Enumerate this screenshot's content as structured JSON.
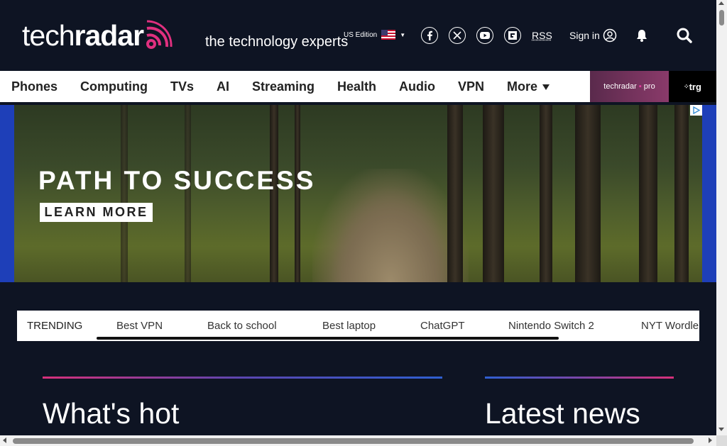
{
  "header": {
    "logo_light": "tech",
    "logo_bold": "radar",
    "tagline": "the technology experts",
    "edition_label": "US Edition",
    "rss_label": "RSS",
    "signin_label": "Sign in"
  },
  "nav": {
    "items": [
      {
        "label": "Phones"
      },
      {
        "label": "Computing"
      },
      {
        "label": "TVs"
      },
      {
        "label": "AI"
      },
      {
        "label": "Streaming"
      },
      {
        "label": "Health"
      },
      {
        "label": "Audio"
      },
      {
        "label": "VPN"
      },
      {
        "label": "More"
      }
    ],
    "pro_label_a": "techradar",
    "pro_label_b": "pro",
    "trg_label": "trg"
  },
  "ad": {
    "title": "PATH TO SUCCESS",
    "cta": "LEARN MORE"
  },
  "trending": {
    "label": "TRENDING",
    "links": [
      {
        "label": "Best VPN"
      },
      {
        "label": "Back to school"
      },
      {
        "label": "Best laptop"
      },
      {
        "label": "ChatGPT"
      },
      {
        "label": "Nintendo Switch 2"
      },
      {
        "label": "NYT Wordle"
      }
    ]
  },
  "sections": {
    "hot_title": "What's hot",
    "latest_title": "Latest news"
  },
  "colors": {
    "background": "#0e1423",
    "accent_pink": "#d6307a",
    "accent_blue": "#2f5fd0",
    "ad_frame": "#1e3fb8"
  }
}
